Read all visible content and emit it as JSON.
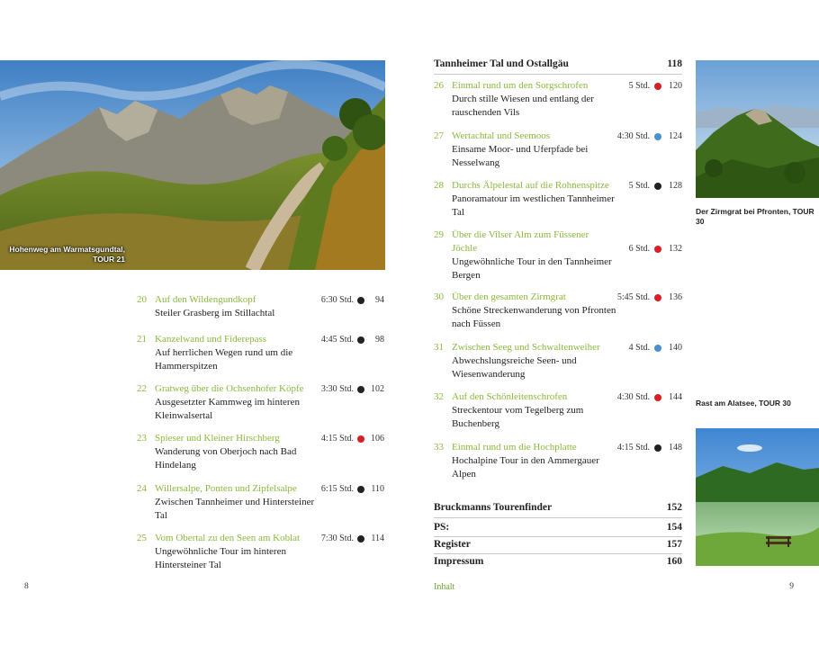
{
  "colors": {
    "green": "#8ab83e",
    "red": "#d71f27",
    "blue": "#4a8fd0",
    "black": "#222222"
  },
  "left_page": {
    "photo_caption": "Hohenweg am Warmatsgundtal, TOUR 21",
    "folio": "8",
    "tours": [
      {
        "num": "20",
        "title": "Auf den Wildengundkopf",
        "duration": "6:30 Std.",
        "difficulty": "black",
        "page": "94",
        "description": "Steiler Grasberg im Stillachtal"
      },
      {
        "num": "21",
        "title": "Kanzelwand und Fiderepass",
        "duration": "4:45 Std.",
        "difficulty": "black",
        "page": "98",
        "description": "Auf herrlichen Wegen rund um die Hammerspitzen"
      },
      {
        "num": "22",
        "title": "Gratweg über die Ochsenhofer Köpfe",
        "duration": "3:30 Std.",
        "difficulty": "black",
        "page": "102",
        "description": "Ausgesetzter Kammweg im hinteren Kleinwalsertal"
      },
      {
        "num": "23",
        "title": "Spieser und Kleiner Hirschberg",
        "duration": "4:15 Std.",
        "difficulty": "red",
        "page": "106",
        "description": "Wanderung von Oberjoch nach Bad Hindelang"
      },
      {
        "num": "24",
        "title": "Willersalpe, Ponten und Zipfelsalpe",
        "duration": "6:15 Std.",
        "difficulty": "black",
        "page": "110",
        "description": "Zwischen Tannheimer und Hintersteiner Tal"
      },
      {
        "num": "25",
        "title": "Vom Obertal zu den Seen am Koblat",
        "duration": "7:30 Std.",
        "difficulty": "black",
        "page": "114",
        "description": "Ungewöhnliche Tour im hinteren Hintersteiner Tal"
      }
    ]
  },
  "right_page": {
    "section": {
      "title": "Tannheimer Tal und Ostallgäu",
      "page": "118"
    },
    "tours": [
      {
        "num": "26",
        "title": "Einmal rund um den Sorgschrofen",
        "duration": "5 Std.",
        "difficulty": "red",
        "page": "120",
        "description": "Durch stille Wiesen und entlang der rauschenden Vils"
      },
      {
        "num": "27",
        "title": "Wertachtal und Seemoos",
        "duration": "4:30 Std.",
        "difficulty": "blue",
        "page": "124",
        "description": "Einsame Moor- und Uferpfade bei Nesselwang"
      },
      {
        "num": "28",
        "title": "Durchs Älpelestal auf die Rohnenspitze",
        "duration": "5 Std.",
        "difficulty": "black",
        "page": "128",
        "description": "Panoramatour im westlichen Tannheimer Tal"
      },
      {
        "num": "29",
        "title": "Über die Vilser Alm zum Füssener Jöchle",
        "duration": "6 Std.",
        "difficulty": "red",
        "page": "132",
        "description": "Ungewöhnliche Tour in den Tannheimer Bergen"
      },
      {
        "num": "30",
        "title": "Über den gesamten Zirmgrat",
        "duration": "5:45 Std.",
        "difficulty": "red",
        "page": "136",
        "description": "Schöne Streckenwanderung von Pfronten nach Füssen"
      },
      {
        "num": "31",
        "title": "Zwischen Seeg und Schwaltenweiher",
        "duration": "4 Std.",
        "difficulty": "blue",
        "page": "140",
        "description": "Abwechslungsreiche Seen- und Wiesenwanderung"
      },
      {
        "num": "32",
        "title": "Auf den Schönleitenschrofen",
        "duration": "4:30 Std.",
        "difficulty": "red",
        "page": "144",
        "description": "Streckentour vom Tegelberg zum Buchenberg"
      },
      {
        "num": "33",
        "title": "Einmal rund um die Hochplatte",
        "duration": "4:15 Std.",
        "difficulty": "black",
        "page": "148",
        "description": "Hochalpine Tour in den Ammergauer Alpen"
      }
    ],
    "back_matter": [
      {
        "label": "Bruckmanns Tourenfinder",
        "page": "152"
      },
      {
        "label": "PS:",
        "page": "154"
      },
      {
        "label": "Register",
        "page": "157"
      },
      {
        "label": "Impressum",
        "page": "160"
      }
    ],
    "photo_caption_top": "Der Zirmgrat bei Pfronten, TOUR 30",
    "photo_caption_bottom": "Rast am Alatsee, TOUR 30",
    "running_head": "Inhalt",
    "folio": "9"
  }
}
